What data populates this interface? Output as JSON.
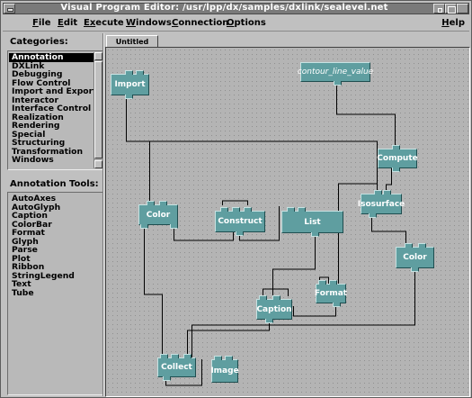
{
  "window": {
    "title": "Visual Program Editor: /usr/lpp/dx/samples/dxlink/sealevel.net"
  },
  "menubar": {
    "items": [
      {
        "label_u": "F",
        "label_rest": "ile"
      },
      {
        "label_u": "E",
        "label_rest": "dit"
      },
      {
        "label_u": "Ex",
        "label_rest": "ecute"
      },
      {
        "label_u": "W",
        "label_rest": "indows"
      },
      {
        "label_u": "C",
        "label_rest": "onnection"
      },
      {
        "label_u": "O",
        "label_rest": "ptions"
      }
    ],
    "help": {
      "label_u": "H",
      "label_rest": "elp"
    }
  },
  "categories": {
    "label": "Categories:",
    "items": [
      "Annotation",
      "DXLink",
      "Debugging",
      "Flow Control",
      "Import and Export",
      "Interactor",
      "Interface Control",
      "Realization",
      "Rendering",
      "Special",
      "Structuring",
      "Transformation",
      "Windows"
    ],
    "selected": "Annotation"
  },
  "tools": {
    "label": "Annotation Tools:",
    "items": [
      "AutoAxes",
      "AutoGlyph",
      "Caption",
      "ColorBar",
      "Format",
      "Glyph",
      "Parse",
      "Plot",
      "Ribbon",
      "StringLegend",
      "Text",
      "Tube"
    ]
  },
  "canvas": {
    "tab_label": "Untitled",
    "modules": {
      "import": "Import",
      "contour": "contour_line_value",
      "compute": "Compute",
      "isosurface": "Isosurface",
      "color1": "Color",
      "construct": "Construct",
      "list": "List",
      "color2": "Color",
      "format": "Format",
      "caption": "Caption",
      "collect": "Collect",
      "image": "Image"
    }
  },
  "colors": {
    "module_fill": "#5f9ea0",
    "canvas_bg": "#b4b4b4",
    "titlebar": "#7a7a7a"
  }
}
